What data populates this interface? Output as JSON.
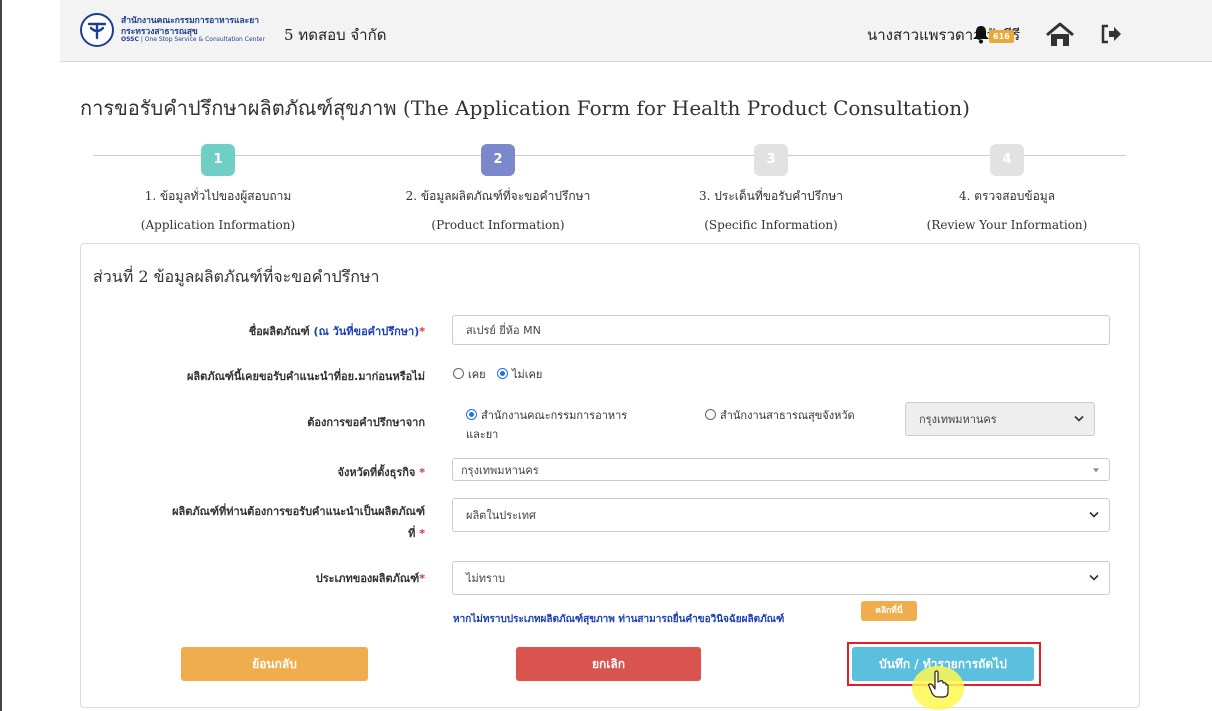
{
  "header": {
    "logo_line1": "สำนักงานคณะกรรมการอาหารและยา",
    "logo_line2": "กระทรวงสาธารณสุข",
    "logo_line3_bold": "OSSC",
    "logo_line3": "| One Stop Service & Consultation Center",
    "company": "5 ทดสอบ จำกัด",
    "user": "นางสาวแพรวดาว วังคีรี",
    "notification_count": "616",
    "icons": [
      "bell-icon",
      "home-icon",
      "logout-icon"
    ]
  },
  "page_title": "การขอรับคำปรึกษาผลิตภัณฑ์สุขภาพ (The Application Form for Health Product Consultation)",
  "wizard": {
    "steps": [
      {
        "num": "1",
        "label": "1. ข้อมูลทั่วไปของผู้สอบถาม",
        "sublabel": "(Application Information)",
        "color": "#6fcfc6"
      },
      {
        "num": "2",
        "label": "2. ข้อมูลผลิตภัณฑ์ที่จะขอคำปรึกษา",
        "sublabel": "(Product Information)",
        "color": "#7b88cc"
      },
      {
        "num": "3",
        "label": "3. ประเด็นที่ขอรับคำปรึกษา",
        "sublabel": "(Specific Information)",
        "color": "#e2e2e2"
      },
      {
        "num": "4",
        "label": "4. ตรวจสอบข้อมูล",
        "sublabel": "(Review Your Information)",
        "color": "#e2e2e2"
      }
    ]
  },
  "section_title": "ส่วนที่ 2 ข้อมูลผลิตภัณฑ์ที่จะขอคำปรึกษา",
  "form": {
    "product_name": {
      "label": "ชื่อผลิตภัณฑ์",
      "label_note": "(ณ วันที่ขอคำปรึกษา)",
      "required": "*",
      "value": "สเปรย์ ยี่ห้อ MN"
    },
    "previously_advised": {
      "label": "ผลิตภัณฑ์นี้เคยขอรับคำแนะนำที่อย.มาก่อนหรือไม่",
      "option_yes": "เคย",
      "option_no": "ไม่เคย",
      "selected": "ไม่เคย"
    },
    "consult_from": {
      "label": "ต้องการขอคำปรึกษาจาก",
      "option_fda_line1": "สำนักงานคณะกรรมการอาหาร",
      "option_fda_line2": "และยา",
      "option_provincial": "สำนักงานสาธารณสุขจังหวัด",
      "selected": "สำนักงานคณะกรรมการอาหารและยา",
      "province_value": "กรุงเทพมหานคร"
    },
    "business_province": {
      "label": "จังหวัดที่ตั้งธุรกิจ",
      "required": "*",
      "value": "กรุงเทพมหานคร"
    },
    "product_origin": {
      "label_line1": "ผลิตภัณฑ์ที่ท่านต้องการขอรับคำแนะนำเป็นผลิตภัณฑ์",
      "label_line2": "ที่",
      "required": "*",
      "value": "ผลิตในประเทศ"
    },
    "product_type": {
      "label": "ประเภทของผลิตภัณฑ์",
      "required": "*",
      "value": "ไม่ทราบ"
    },
    "hint": "หากไม่ทราบประเภทผลิตภัณฑ์สุขภาพ ท่านสามารถยื่นคำขอวินิจฉัยผลิตภัณฑ์",
    "hint_button": "คลิกที่นี่"
  },
  "buttons": {
    "back": "ย้อนกลับ",
    "cancel": "ยกเลิก",
    "next": "บันทึก / ทำรายการถัดไป"
  }
}
